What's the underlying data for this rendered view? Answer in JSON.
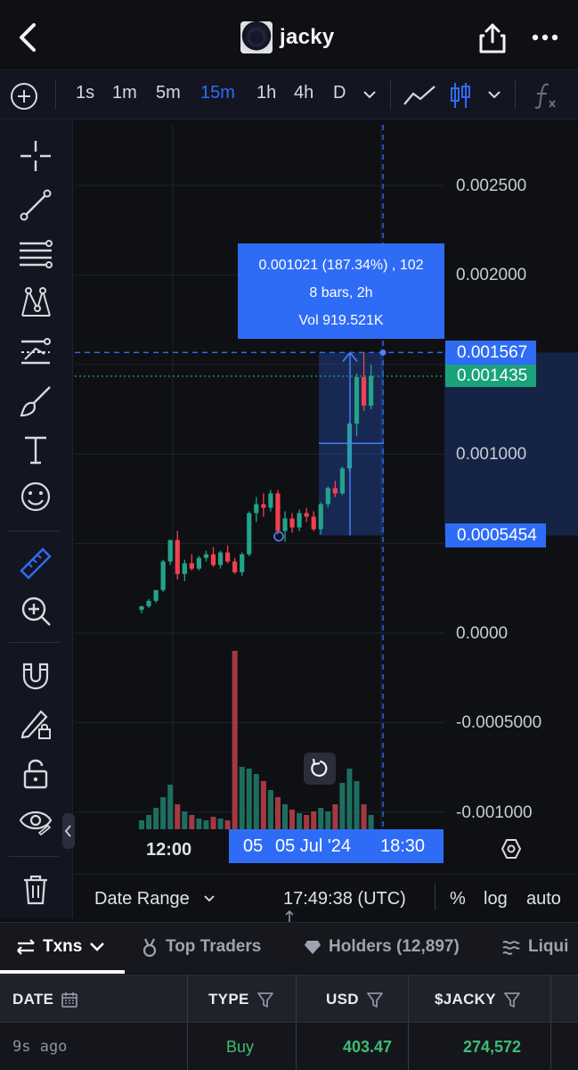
{
  "header": {
    "title": "jacky",
    "back_icon": "chevron-left-icon",
    "share_icon": "share-icon",
    "more_icon": "more-horizontal-icon"
  },
  "toolbar": {
    "timeframes": [
      "1s",
      "1m",
      "5m",
      "15m",
      "1h",
      "4h",
      "D"
    ],
    "active_timeframe": "15m",
    "active_color": "#2f6cf6"
  },
  "tools": [
    "crosshair-icon",
    "trend-line-icon",
    "fib-lines-icon",
    "pattern-icon",
    "projection-icon",
    "brush-icon",
    "text-icon",
    "emoji-icon",
    "ruler-icon",
    "zoom-in-icon",
    "magnet-icon",
    "lock-drawing-icon",
    "unlock-icon",
    "eye-icon",
    "trash-icon"
  ],
  "chart": {
    "price_labels": [
      "0.002500",
      "0.002000",
      "0.001000",
      "0.0000",
      "-0.0005000",
      "-0.001000"
    ],
    "crosshair_price": "0.001567",
    "last_price": "0.001435",
    "range_low": "0.0005454",
    "measure": {
      "line1": "0.001021 (187.34%) , 102",
      "line2": "8 bars, 2h",
      "line3": "Vol 919.521K"
    },
    "colors": {
      "up": "#22a38a",
      "down": "#f0414f",
      "volume_up": "#1e6e5f",
      "volume_down": "#a33a43",
      "accent": "#2f6cf6",
      "last_price": "#1aa37a"
    }
  },
  "chart_data": {
    "type": "candlestick",
    "title": "",
    "xlabel": "",
    "ylabel": "",
    "ylim": [
      -0.0011,
      0.0027
    ],
    "x_tick_labels": [
      "12:00",
      "18:30"
    ],
    "candles": [
      {
        "o": 0.00013,
        "h": 0.00015,
        "l": 0.00011,
        "c": 0.00015
      },
      {
        "o": 0.00015,
        "h": 0.00019,
        "l": 0.00014,
        "c": 0.00018
      },
      {
        "o": 0.00018,
        "h": 0.00024,
        "l": 0.00017,
        "c": 0.00024
      },
      {
        "o": 0.00024,
        "h": 0.00041,
        "l": 0.00023,
        "c": 0.0004
      },
      {
        "o": 0.0004,
        "h": 0.00052,
        "l": 0.00038,
        "c": 0.00052
      },
      {
        "o": 0.00052,
        "h": 0.00057,
        "l": 0.0003,
        "c": 0.00033
      },
      {
        "o": 0.00033,
        "h": 0.00041,
        "l": 0.00029,
        "c": 0.00039
      },
      {
        "o": 0.00039,
        "h": 0.00044,
        "l": 0.00035,
        "c": 0.00036
      },
      {
        "o": 0.00036,
        "h": 0.00043,
        "l": 0.00035,
        "c": 0.00042
      },
      {
        "o": 0.00042,
        "h": 0.00046,
        "l": 0.0004,
        "c": 0.00044
      },
      {
        "o": 0.00044,
        "h": 0.00048,
        "l": 0.00037,
        "c": 0.00038
      },
      {
        "o": 0.00038,
        "h": 0.00046,
        "l": 0.00036,
        "c": 0.00045
      },
      {
        "o": 0.00045,
        "h": 0.00049,
        "l": 0.00039,
        "c": 0.0004
      },
      {
        "o": 0.0004,
        "h": 0.00042,
        "l": 0.00033,
        "c": 0.00034
      },
      {
        "o": 0.00034,
        "h": 0.00045,
        "l": 0.00032,
        "c": 0.00044
      },
      {
        "o": 0.00044,
        "h": 0.00068,
        "l": 0.00043,
        "c": 0.00067
      },
      {
        "o": 0.00067,
        "h": 0.00076,
        "l": 0.00062,
        "c": 0.00072
      },
      {
        "o": 0.00072,
        "h": 0.00078,
        "l": 0.00065,
        "c": 0.0007
      },
      {
        "o": 0.0007,
        "h": 0.0008,
        "l": 0.00068,
        "c": 0.00078
      },
      {
        "o": 0.00078,
        "h": 0.0008,
        "l": 0.00055,
        "c": 0.00057
      },
      {
        "o": 0.00057,
        "h": 0.00068,
        "l": 0.00051,
        "c": 0.00064
      },
      {
        "o": 0.00064,
        "h": 0.00067,
        "l": 0.00056,
        "c": 0.00059
      },
      {
        "o": 0.00059,
        "h": 0.00069,
        "l": 0.00057,
        "c": 0.00067
      },
      {
        "o": 0.00067,
        "h": 0.0007,
        "l": 0.00062,
        "c": 0.00065
      },
      {
        "o": 0.00065,
        "h": 0.00068,
        "l": 0.00057,
        "c": 0.00058
      },
      {
        "o": 0.00058,
        "h": 0.00073,
        "l": 0.00055,
        "c": 0.00072
      },
      {
        "o": 0.00072,
        "h": 0.00082,
        "l": 0.0007,
        "c": 0.00081
      },
      {
        "o": 0.00081,
        "h": 0.00085,
        "l": 0.00076,
        "c": 0.00078
      },
      {
        "o": 0.00078,
        "h": 0.00093,
        "l": 0.00077,
        "c": 0.00092
      },
      {
        "o": 0.00092,
        "h": 0.00118,
        "l": 0.0009,
        "c": 0.00117
      },
      {
        "o": 0.00117,
        "h": 0.00145,
        "l": 0.0011,
        "c": 0.00143
      },
      {
        "o": 0.00143,
        "h": 0.00157,
        "l": 0.00124,
        "c": 0.00127
      },
      {
        "o": 0.00127,
        "h": 0.0015,
        "l": 0.00125,
        "c": 0.001435
      }
    ],
    "volume_relative": [
      0.05,
      0.08,
      0.12,
      0.18,
      0.25,
      0.14,
      0.1,
      0.08,
      0.06,
      0.05,
      0.07,
      0.06,
      0.05,
      1.0,
      0.35,
      0.34,
      0.31,
      0.27,
      0.22,
      0.18,
      0.14,
      0.11,
      0.09,
      0.08,
      0.1,
      0.12,
      0.1,
      0.14,
      0.26,
      0.34,
      0.27,
      0.14,
      0.08
    ],
    "grid": true
  },
  "time_axis": {
    "left_label": "12:00",
    "badge_left": "05",
    "badge_center": "05 Jul '24",
    "badge_right": "18:30",
    "settings_icon": "hex-gear-icon"
  },
  "footer": {
    "date_range": "Date Range",
    "clock": "17:49:38 (UTC)",
    "percent": "%",
    "log": "log",
    "auto": "auto"
  },
  "tabs": [
    {
      "label": "Txns",
      "icon": "swap-icon",
      "active": true
    },
    {
      "label": "Top Traders",
      "icon": "medal-icon",
      "active": false
    },
    {
      "label": "Holders (12,897)",
      "icon": "diamond-icon",
      "active": false
    },
    {
      "label": "Liqui",
      "icon": "liquidity-icon",
      "active": false
    }
  ],
  "table": {
    "headers": [
      "DATE",
      "TYPE",
      "USD",
      "$JACKY"
    ],
    "rows": [
      {
        "date": "9s ago",
        "type": "Buy",
        "usd": "403.47",
        "amount": "274,572"
      }
    ],
    "buy_color": "#3dbd77"
  }
}
